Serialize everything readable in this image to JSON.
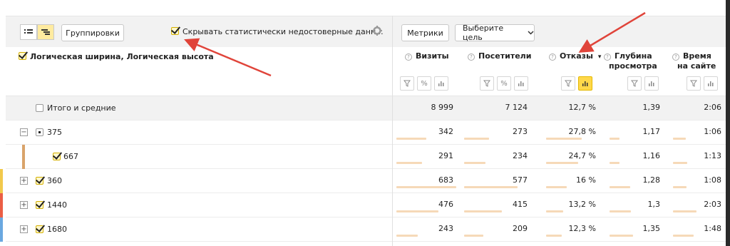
{
  "toolbar": {
    "groupings_label": "Группировки",
    "hide_unreliable_label": "Скрывать статистически недостоверные данн...",
    "metrics_label": "Метрики",
    "goal_select_label": "Выберите цель"
  },
  "header": {
    "dimension_label": "Логическая ширина, Логическая высота",
    "columns": [
      {
        "line1": "Визиты",
        "line2": ""
      },
      {
        "line1": "Посетители",
        "line2": ""
      },
      {
        "line1": "Отказы",
        "line2": ""
      },
      {
        "line1": "Глубина",
        "line2": "просмотра"
      },
      {
        "line1": "Время",
        "line2": "на сайте"
      }
    ],
    "sort_indicator": "▾"
  },
  "totals": {
    "label": "Итого и средние",
    "values": [
      "8 999",
      "7 124",
      "12,7 %",
      "1,39",
      "2:06"
    ]
  },
  "rows": [
    {
      "label": "375",
      "values": [
        "342",
        "273",
        "27,8 %",
        "1,17",
        "1:06"
      ],
      "bars": [
        0.5,
        0.38,
        0.72,
        0.2,
        0.3
      ],
      "expander": "−"
    },
    {
      "label": "667",
      "values": [
        "291",
        "234",
        "24,7 %",
        "1,16",
        "1:13"
      ],
      "bars": [
        0.43,
        0.33,
        0.64,
        0.2,
        0.33
      ],
      "expander": ""
    },
    {
      "label": "360",
      "values": [
        "683",
        "577",
        "16 %",
        "1,28",
        "1:08"
      ],
      "bars": [
        1.0,
        0.81,
        0.42,
        0.4,
        0.31
      ],
      "expander": "+"
    },
    {
      "label": "1440",
      "values": [
        "476",
        "415",
        "13,2 %",
        "1,3",
        "2:03"
      ],
      "bars": [
        0.7,
        0.58,
        0.34,
        0.42,
        0.55
      ],
      "expander": "+"
    },
    {
      "label": "1680",
      "values": [
        "243",
        "209",
        "12,3 %",
        "1,35",
        "1:48"
      ],
      "bars": [
        0.36,
        0.29,
        0.32,
        0.46,
        0.48
      ],
      "expander": "+"
    }
  ],
  "colors": {
    "row_stripe_360": "#f2c94c",
    "row_stripe_1440": "#eb5e45",
    "row_stripe_1680": "#6aa8e0",
    "child_stripe": "#d9a36a",
    "arrow": "#e0443a",
    "active_control": "#ffd84a"
  }
}
